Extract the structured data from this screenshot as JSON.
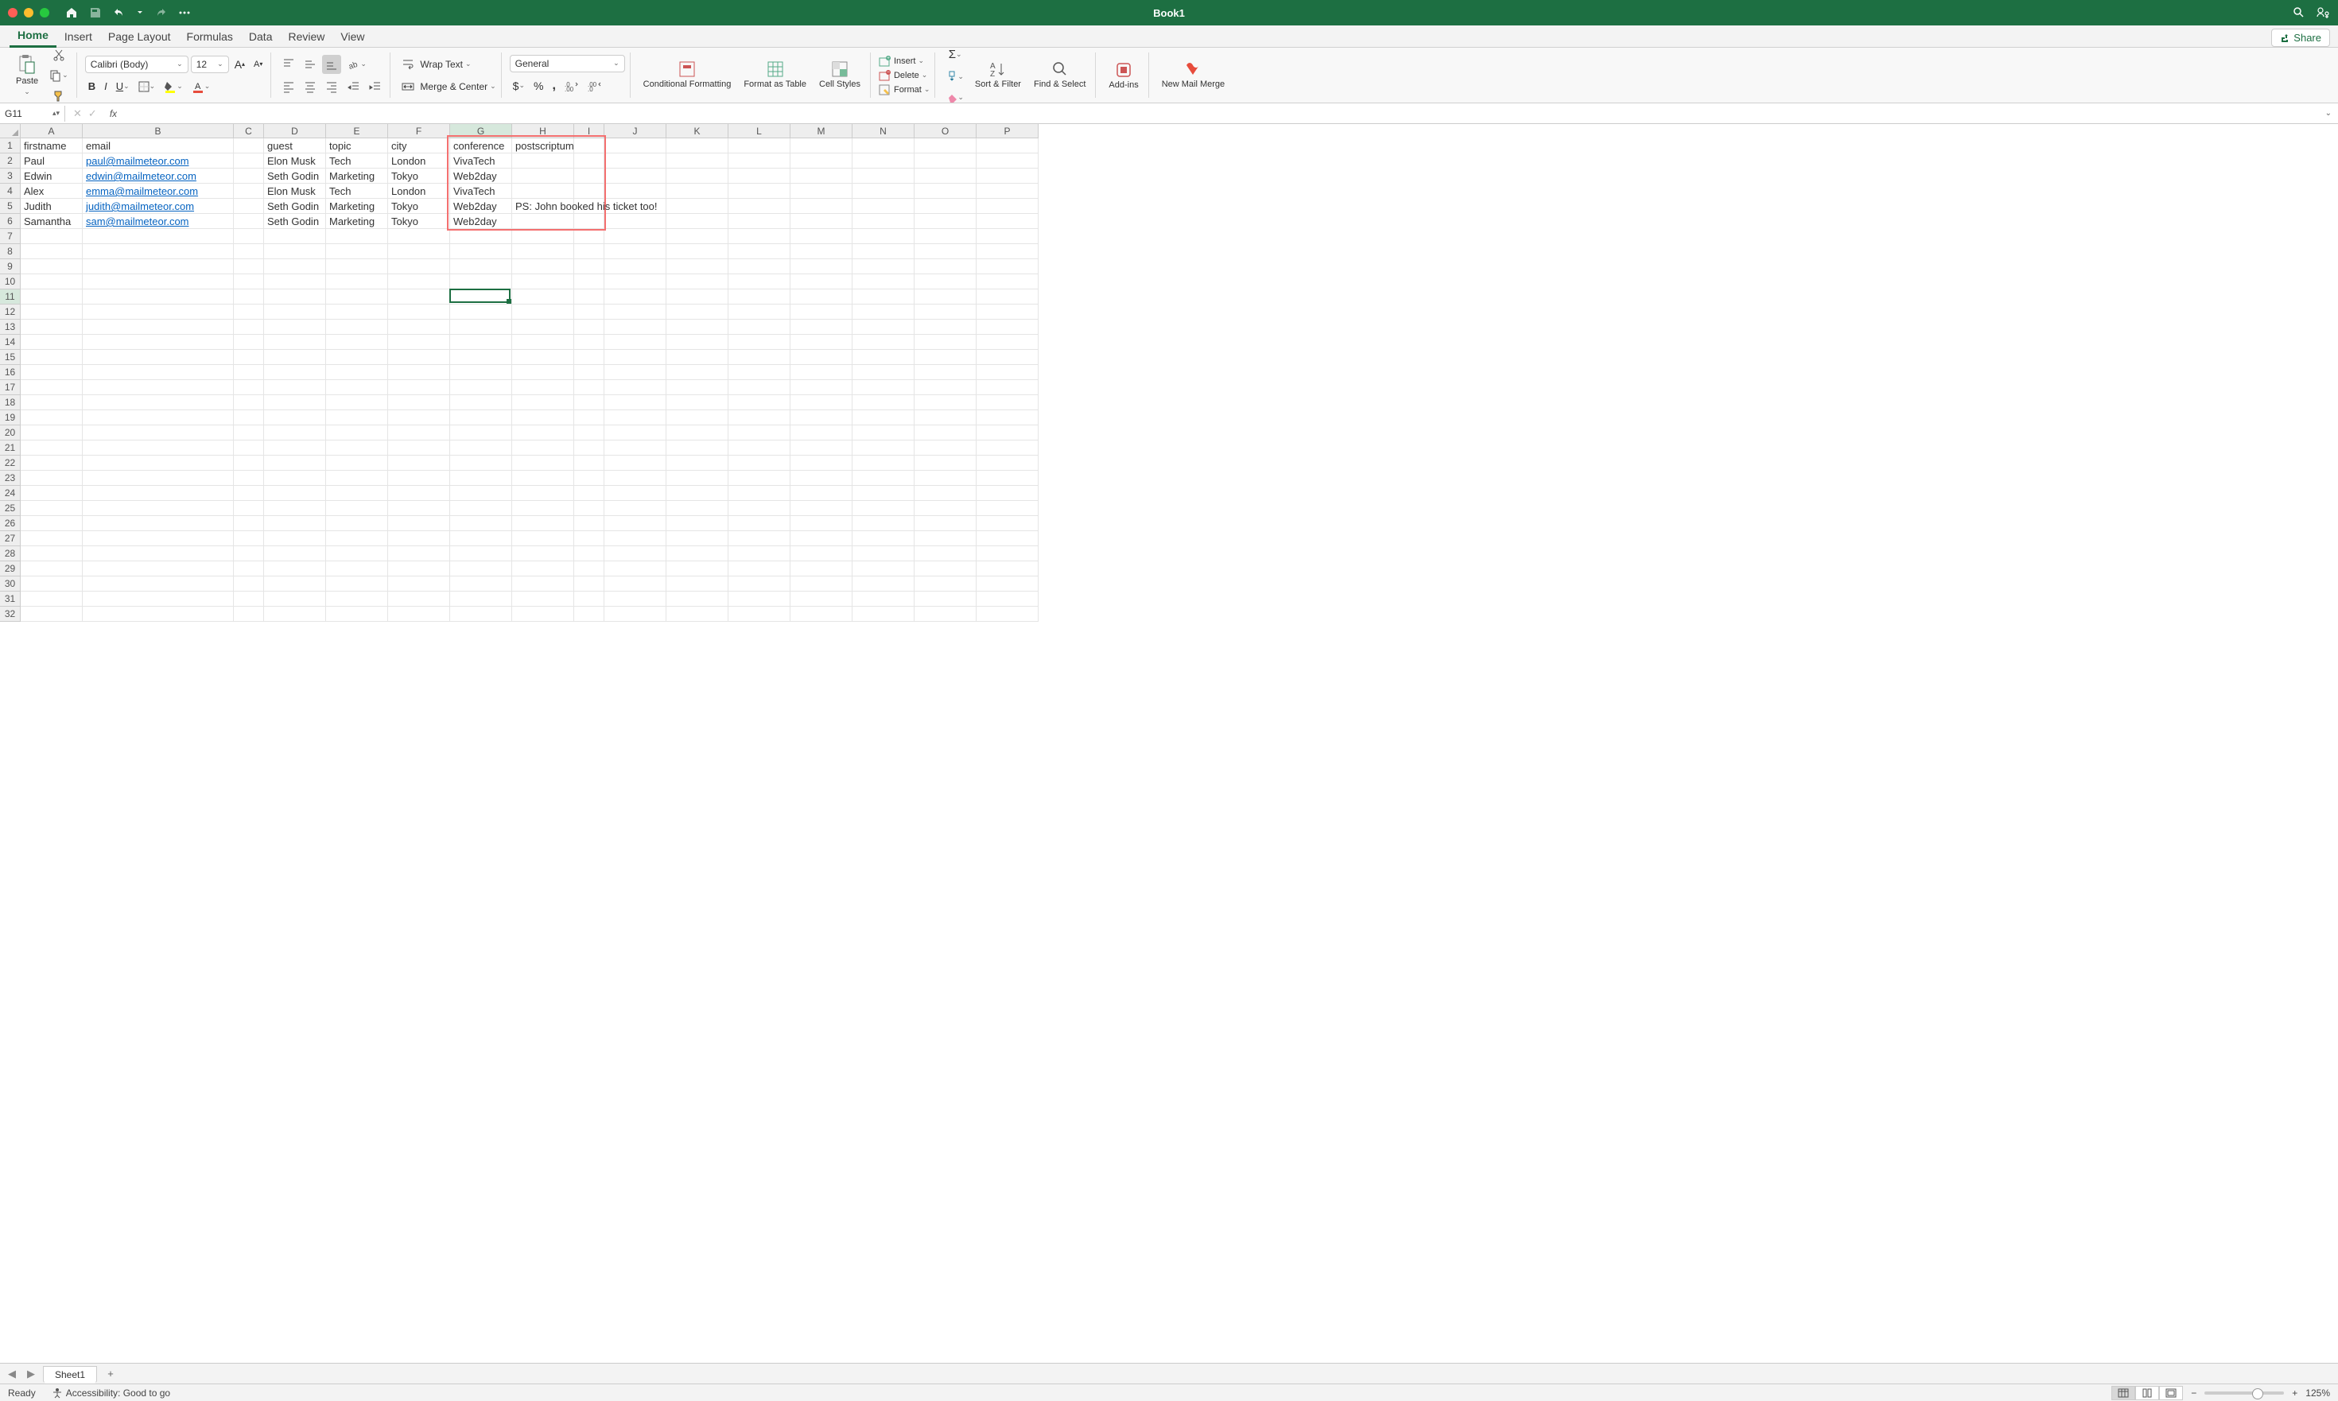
{
  "title": "Book1",
  "tabs": [
    "Home",
    "Insert",
    "Page Layout",
    "Formulas",
    "Data",
    "Review",
    "View"
  ],
  "active_tab": "Home",
  "share_label": "Share",
  "ribbon": {
    "paste": "Paste",
    "font_name": "Calibri (Body)",
    "font_size": "12",
    "wrap_text": "Wrap Text",
    "merge_center": "Merge & Center",
    "number_format": "General",
    "conditional_formatting": "Conditional Formatting",
    "format_as_table": "Format as Table",
    "cell_styles": "Cell Styles",
    "insert": "Insert",
    "delete": "Delete",
    "format": "Format",
    "sort_filter": "Sort & Filter",
    "find_select": "Find & Select",
    "addins": "Add-ins",
    "mailmerge": "New Mail Merge"
  },
  "namebox": "G11",
  "columns": [
    {
      "letter": "A",
      "width": 78
    },
    {
      "letter": "B",
      "width": 190
    },
    {
      "letter": "C",
      "width": 38
    },
    {
      "letter": "D",
      "width": 78
    },
    {
      "letter": "E",
      "width": 78
    },
    {
      "letter": "F",
      "width": 78
    },
    {
      "letter": "G",
      "width": 78
    },
    {
      "letter": "H",
      "width": 78
    },
    {
      "letter": "I",
      "width": 38
    },
    {
      "letter": "J",
      "width": 78
    },
    {
      "letter": "K",
      "width": 78
    },
    {
      "letter": "L",
      "width": 78
    },
    {
      "letter": "M",
      "width": 78
    },
    {
      "letter": "N",
      "width": 78
    },
    {
      "letter": "O",
      "width": 78
    },
    {
      "letter": "P",
      "width": 78
    }
  ],
  "row_count": 32,
  "active_cell": {
    "col": 6,
    "row": 10
  },
  "highlight_box": {
    "col_start": 6,
    "row_start": 0,
    "col_end": 8,
    "row_end": 5
  },
  "data_rows": [
    [
      "firstname",
      "email",
      "",
      "guest",
      "topic",
      "city",
      "conference",
      "postscriptum"
    ],
    [
      "Paul",
      "paul@mailmeteor.com",
      "",
      "Elon Musk",
      "Tech",
      "London",
      "VivaTech",
      ""
    ],
    [
      "Edwin",
      "edwin@mailmeteor.com",
      "",
      "Seth Godin",
      "Marketing",
      "Tokyo",
      "Web2day",
      ""
    ],
    [
      "Alex",
      "emma@mailmeteor.com",
      "",
      "Elon Musk",
      "Tech",
      "London",
      "VivaTech",
      ""
    ],
    [
      "Judith",
      "judith@mailmeteor.com",
      "",
      "Seth Godin",
      "Marketing",
      "Tokyo",
      "Web2day",
      "PS: John booked his ticket too!"
    ],
    [
      "Samantha",
      "sam@mailmeteor.com",
      "",
      "Seth Godin",
      "Marketing",
      "Tokyo",
      "Web2day",
      ""
    ]
  ],
  "link_columns": [
    1
  ],
  "sheet_tab": "Sheet1",
  "status_ready": "Ready",
  "status_accessibility": "Accessibility: Good to go",
  "zoom": "125%"
}
